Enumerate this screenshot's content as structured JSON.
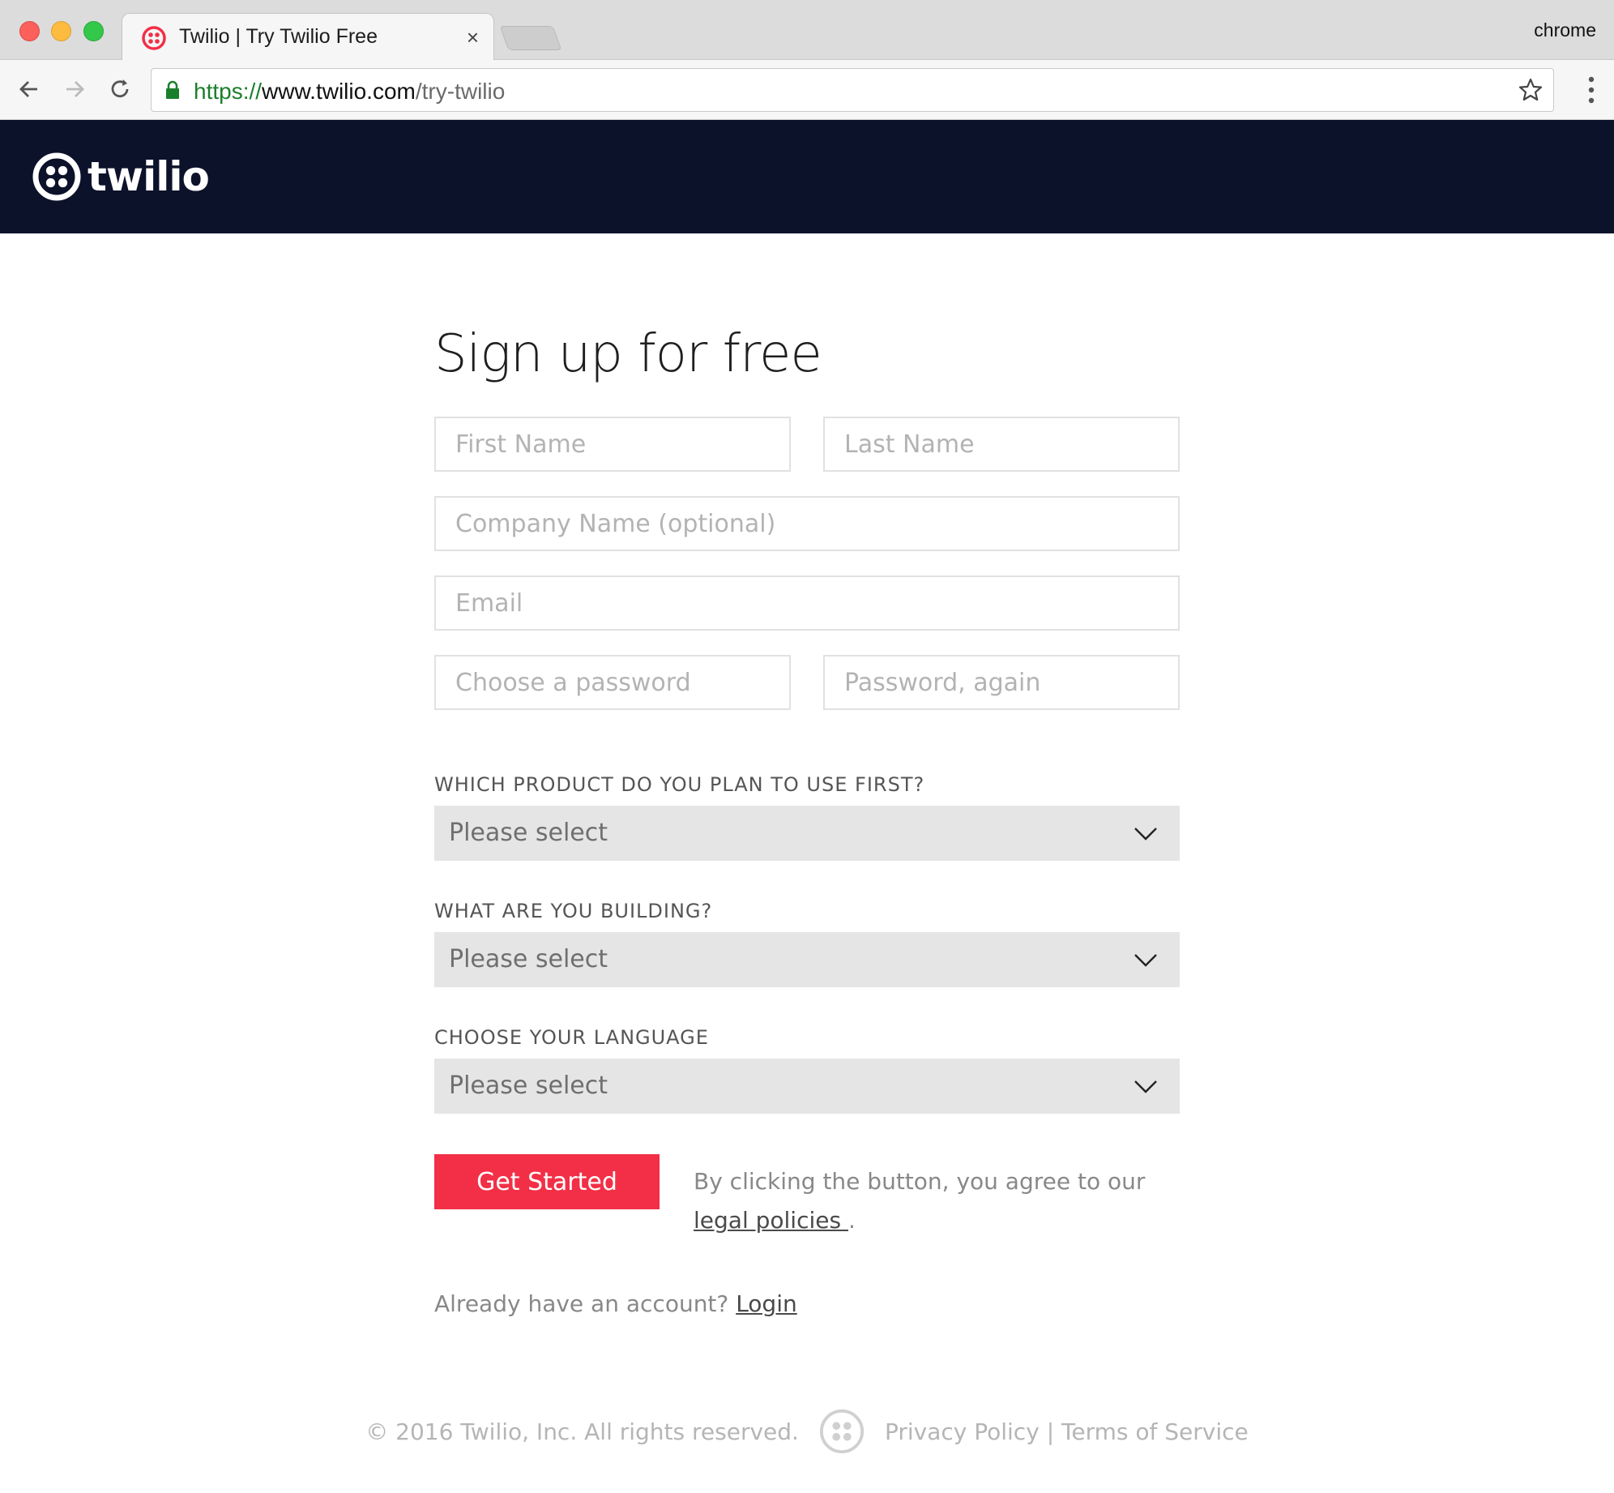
{
  "browser": {
    "tab_title": "Twilio | Try Twilio Free",
    "tab_close": "×",
    "profile_name": "chrome",
    "url_scheme": "https://",
    "url_host": "www.twilio.com",
    "url_path": "/try-twilio"
  },
  "header": {
    "logo_text": "twilio"
  },
  "form": {
    "title": "Sign up for free",
    "first_name_placeholder": "First Name",
    "last_name_placeholder": "Last Name",
    "company_placeholder": "Company Name (optional)",
    "email_placeholder": "Email",
    "password_placeholder": "Choose a password",
    "password_again_placeholder": "Password, again",
    "product_label": "WHICH PRODUCT DO YOU PLAN TO USE FIRST?",
    "building_label": "WHAT ARE YOU BUILDING?",
    "language_label": "CHOOSE YOUR LANGUAGE",
    "select_value": "Please select",
    "submit_label": "Get Started",
    "legal_prefix": "By clicking the button, you agree to our ",
    "legal_link": "legal policies ",
    "legal_suffix": ".",
    "login_prefix": "Already have an account? ",
    "login_link": "Login"
  },
  "footer": {
    "copyright": "© 2016 Twilio, Inc. All rights reserved.",
    "privacy": "Privacy Policy",
    "separator": "|",
    "terms": "Terms of Service"
  },
  "colors": {
    "brand_red": "#f22f46",
    "header_navy": "#0d122b"
  },
  "icons": [
    "back-arrow-icon",
    "forward-arrow-icon",
    "reload-icon",
    "lock-icon",
    "star-icon",
    "menu-dots-icon",
    "chevron-down-icon",
    "twilio-logo-icon"
  ]
}
